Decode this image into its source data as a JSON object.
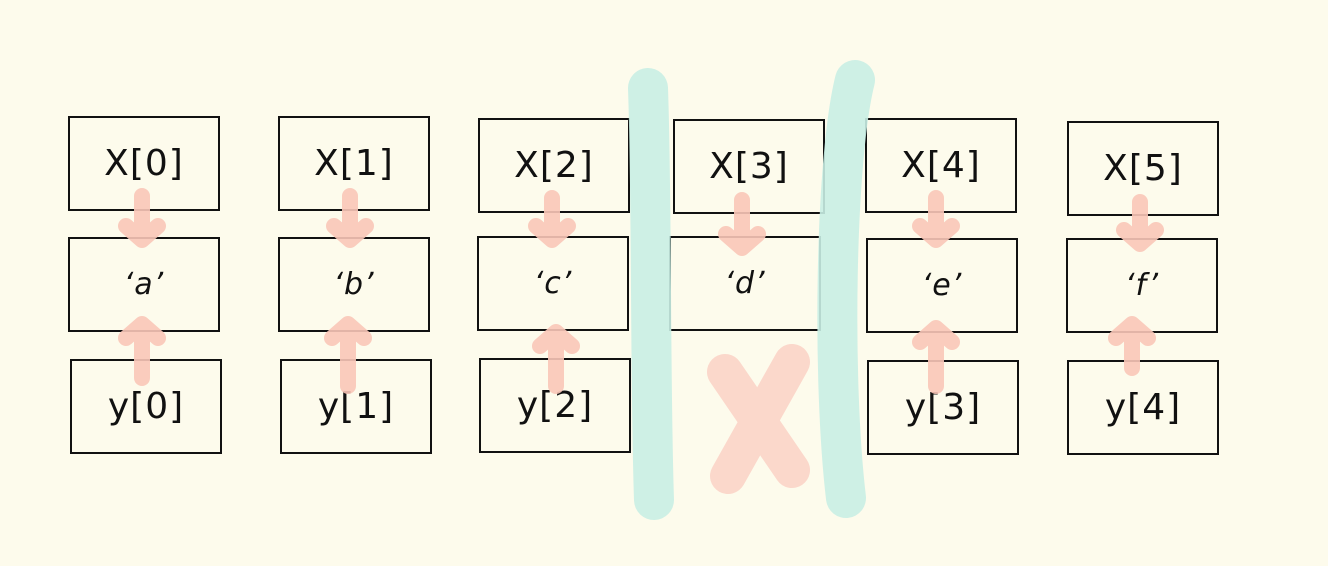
{
  "diagram": {
    "x_cells": [
      "X[0]",
      "X[1]",
      "X[2]",
      "X[3]",
      "X[4]",
      "X[5]"
    ],
    "mid_cells": [
      "‘a’",
      "‘b’",
      "‘c’",
      "‘d’",
      "‘e’",
      "‘f’"
    ],
    "y_cells": [
      "y[0]",
      "y[1]",
      "y[2]",
      "y[3]",
      "y[4]"
    ],
    "colors": {
      "background": "#fdfbec",
      "box_stroke": "#111111",
      "arrow": "#f9c6b8",
      "divider": "#c9eee4",
      "cross": "#fbd2c6"
    }
  }
}
